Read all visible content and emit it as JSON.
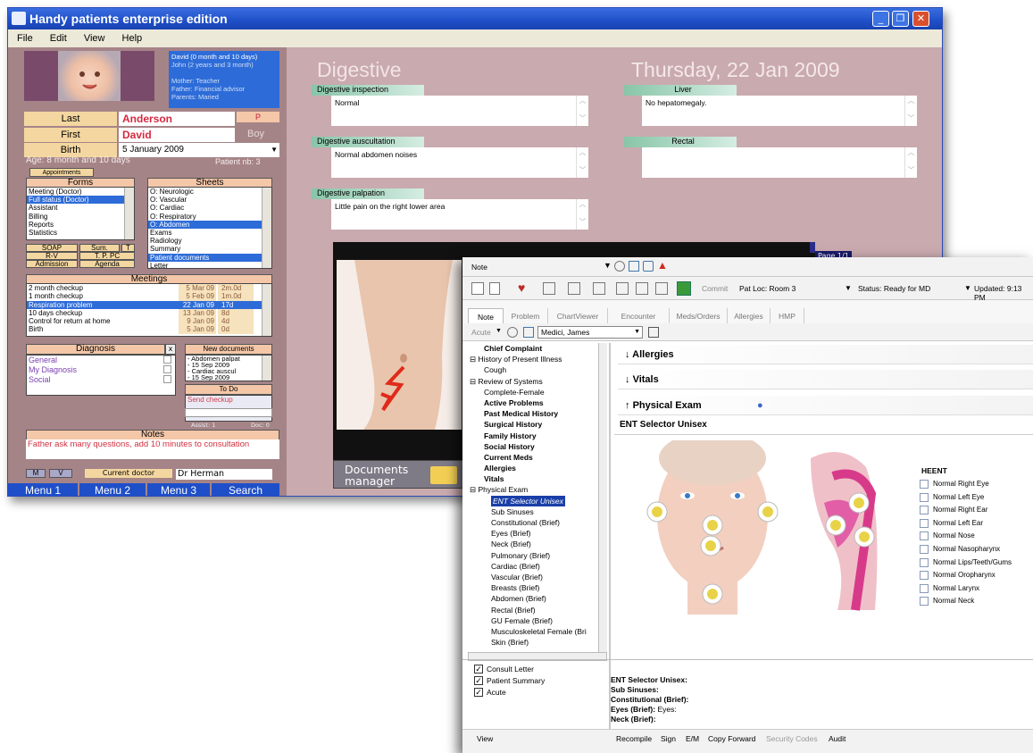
{
  "window1": {
    "title": "Handy patients enterprise edition",
    "menu": [
      "File",
      "Edit",
      "View",
      "Help"
    ],
    "patient_info": [
      "David (0 month and 10 days)",
      "John (2 years and 3 month)",
      "",
      "Mother: Teacher",
      "Father: Financial advisor",
      "Parents: Maried"
    ],
    "fields": {
      "last_label": "Last",
      "last_value": "Anderson",
      "p_button": "P",
      "first_label": "First",
      "first_value": "David",
      "sex": "Boy",
      "birth_label": "Birth",
      "birth_value": "5  January  2009"
    },
    "age_text": "Age: 8 month and 10 days",
    "patient_nb": "Patient nb: 3",
    "appointments_button": "Appointments",
    "forms": {
      "title": "Forms",
      "items": [
        "Meeting (Doctor)",
        "Full status (Doctor)",
        "Assistant",
        "Billing",
        "Reports",
        "Statistics"
      ],
      "selected": 1
    },
    "sheets": {
      "title": "Sheets",
      "items": [
        "O: Neurologic",
        "O: Vascular",
        "O: Cardiac",
        "O: Respiratory",
        "O: Abdomen",
        "Exams",
        "Radiology",
        "Summary",
        "Patient documents",
        "Letter"
      ],
      "selected": [
        4,
        8
      ]
    },
    "buttons_row": [
      "SOAP",
      "Sum.",
      "T",
      "R-V",
      "T. P. PC",
      "Admission",
      "Agenda"
    ],
    "meetings": {
      "title": "Meetings",
      "rows": [
        {
          "name": "2 month checkup",
          "date": "5 Mar 09",
          "dur": "2m.0d"
        },
        {
          "name": "1 month checkup",
          "date": "5 Feb 09",
          "dur": "1m.0d"
        },
        {
          "name": "Respiration problem",
          "date": "22 Jan 09",
          "dur": "17d"
        },
        {
          "name": "10 days checkup",
          "date": "13 Jan 09",
          "dur": "8d"
        },
        {
          "name": "Control for return at home",
          "date": "9 Jan 09",
          "dur": "4d"
        },
        {
          "name": "Birth",
          "date": "5 Jan 09",
          "dur": "0d"
        }
      ],
      "selected": 2
    },
    "diagnosis": {
      "title": "Diagnosis",
      "close": "x",
      "items": [
        "General",
        "My Diagnosis",
        "Social"
      ]
    },
    "new_documents": {
      "title": "New documents",
      "items": [
        "- Abdomen palpat",
        "- 15 Sep 2009",
        "- Cardiac auscul",
        "- 15 Sep 2009"
      ]
    },
    "todo": {
      "title": "To Do",
      "items": [
        "Send checkup"
      ]
    },
    "assist": "Assist: 1",
    "doc": "Doc: 0",
    "notes": {
      "title": "Notes",
      "text": "Father ask many questions, add 10 minutes to consultation"
    },
    "doctor": {
      "m": "M",
      "v": "V",
      "label": "Current doctor",
      "value": "Dr Herman"
    },
    "bottom_menu": [
      "Menu 1",
      "Menu 2",
      "Menu 3",
      "Search"
    ],
    "main": {
      "section": "Digestive",
      "date": "Thursday, 22 Jan 2009",
      "digestive_inspection": {
        "label": "Digestive inspection",
        "value": "Normal"
      },
      "liver": {
        "label": "Liver",
        "value": "No hepatomegaly."
      },
      "digestive_auscultation": {
        "label": "Digestive auscultation",
        "value": "Normal abdomen noises"
      },
      "rectal": {
        "label": "Rectal",
        "value": ""
      },
      "digestive_palpation": {
        "label": "Digestive palpation",
        "value": "Little pain on the right lower area"
      },
      "page": "Page 1/1",
      "documents_manager": "Documents manager"
    }
  },
  "window2": {
    "note_label": "Note",
    "toolbar": {
      "commit": "Commit",
      "pat_loc": "Pat Loc: Room 3",
      "status": "Status:  Ready for MD",
      "updated": "Updated: 9:13 PM"
    },
    "tabs": [
      "Note",
      "Problem",
      "ChartViewer",
      "Encounter",
      "Meds/Orders",
      "Allergies",
      "HMP"
    ],
    "filter": {
      "acute": "Acute",
      "provider": "Medici, James"
    },
    "tree": [
      {
        "t": "Chief Complaint",
        "k": "b"
      },
      {
        "t": "History of Present Illness",
        "k": "pm"
      },
      {
        "t": "Cough",
        "k": "g"
      },
      {
        "t": "Review of Systems",
        "k": "pm"
      },
      {
        "t": "Complete-Female",
        "k": "g"
      },
      {
        "t": "Active Problems",
        "k": "b"
      },
      {
        "t": "Past Medical History",
        "k": "b"
      },
      {
        "t": "Surgical History",
        "k": "b"
      },
      {
        "t": "Family History",
        "k": "b"
      },
      {
        "t": "Social History",
        "k": "b"
      },
      {
        "t": "Current Meds",
        "k": "b"
      },
      {
        "t": "Allergies",
        "k": "b"
      },
      {
        "t": "Vitals",
        "k": "b"
      },
      {
        "t": "Physical Exam",
        "k": "pm"
      },
      {
        "t": "ENT Selector Unisex",
        "k": "sel"
      },
      {
        "t": "Sub Sinuses",
        "k": "ind"
      },
      {
        "t": "Constitutional (Brief)",
        "k": "ind"
      },
      {
        "t": "Eyes (Brief)",
        "k": "ind"
      },
      {
        "t": "Neck (Brief)",
        "k": "ind"
      },
      {
        "t": "Pulmonary (Brief)",
        "k": "ind"
      },
      {
        "t": "Cardiac (Brief)",
        "k": "ind"
      },
      {
        "t": "Vascular (Brief)",
        "k": "ind"
      },
      {
        "t": "Breasts (Brief)",
        "k": "ind"
      },
      {
        "t": "Abdomen (Brief)",
        "k": "ind"
      },
      {
        "t": "Rectal (Brief)",
        "k": "ind"
      },
      {
        "t": "GU Female (Brief)",
        "k": "ind"
      },
      {
        "t": "Musculoskeletal Female (Bri",
        "k": "ind"
      },
      {
        "t": "Skin (Brief)",
        "k": "ind"
      }
    ],
    "sections": {
      "allergies": "Allergies",
      "vitals": "Vitals",
      "physical_exam": "Physical Exam"
    },
    "selector_title": "ENT Selector Unisex",
    "heent": {
      "title": "HEENT",
      "items": [
        "Normal Right Eye",
        "Normal Left Eye",
        "Normal Right Ear",
        "Normal Left Ear",
        "Normal Nose",
        "Normal Nasopharynx",
        "Normal Lips/Teeth/Gums",
        "Normal Oropharynx",
        "Normal Larynx",
        "Normal Neck"
      ]
    },
    "bottom_checks": [
      "Consult Letter",
      "Patient Summary",
      "Acute"
    ],
    "output": [
      {
        "label": "ENT Selector Unisex:",
        "value": ""
      },
      {
        "label": "Sub Sinuses:",
        "value": ""
      },
      {
        "label": "Constitutional (Brief):",
        "value": ""
      },
      {
        "label": "Eyes (Brief):",
        "value": "Eyes:"
      },
      {
        "label": "Neck (Brief):",
        "value": ""
      }
    ],
    "footer": {
      "view": "View",
      "items": [
        "Recompile",
        "Sign",
        "E/M",
        "Copy Forward",
        "Security Codes",
        "Audit"
      ]
    }
  },
  "colors": {
    "title_blue": "#1f4fc8",
    "panel_rose": "#c9aaae",
    "accent_green": "#88c5a8",
    "label_tan": "#f4d7a0",
    "selection": "#2d6cd8"
  }
}
